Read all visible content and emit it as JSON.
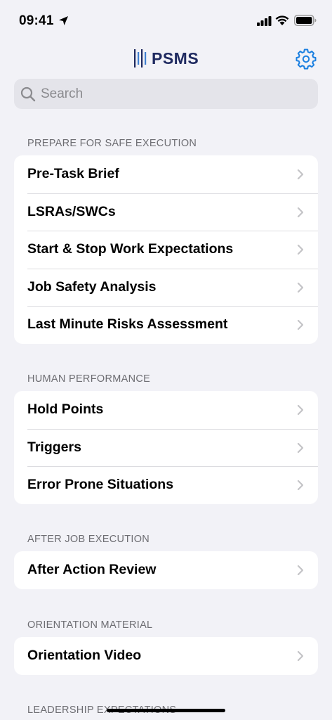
{
  "status_bar": {
    "time": "09:41"
  },
  "header": {
    "app_name": "PSMS"
  },
  "search": {
    "placeholder": "Search"
  },
  "sections": [
    {
      "title": "PREPARE FOR SAFE EXECUTION",
      "items": [
        {
          "label": "Pre-Task Brief"
        },
        {
          "label": "LSRAs/SWCs"
        },
        {
          "label": "Start & Stop Work Expectations"
        },
        {
          "label": "Job Safety Analysis"
        },
        {
          "label": "Last Minute Risks Assessment"
        }
      ]
    },
    {
      "title": "HUMAN PERFORMANCE",
      "items": [
        {
          "label": "Hold Points"
        },
        {
          "label": "Triggers"
        },
        {
          "label": "Error Prone Situations"
        }
      ]
    },
    {
      "title": "AFTER JOB EXECUTION",
      "items": [
        {
          "label": "After Action Review"
        }
      ]
    },
    {
      "title": "ORIENTATION MATERIAL",
      "items": [
        {
          "label": "Orientation Video"
        }
      ]
    },
    {
      "title": "LEADERSHIP EXPECTATIONS",
      "items": []
    }
  ],
  "colors": {
    "accent": "#1a7fe0",
    "background": "#f2f2f7",
    "brand": "#1f2a60"
  },
  "icons": [
    "location-arrow-icon",
    "signal-icon",
    "wifi-icon",
    "battery-icon",
    "gear-icon",
    "search-icon",
    "chevron-right-icon"
  ]
}
